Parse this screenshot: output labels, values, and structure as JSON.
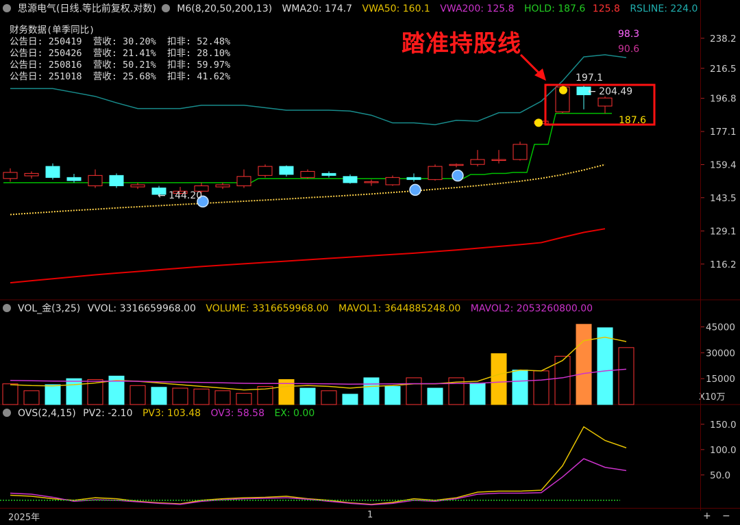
{
  "header_main": {
    "title": "思源电气(日线.等比前复权.对数)",
    "m6": "M6(8,20,50,200,13)",
    "wma20": "WMA20: 174.7",
    "vwa50": "VWA50: 160.1",
    "vwa200": "VWA200: 125.8",
    "hold_a": "HOLD: 187.6",
    "hold_b": "125.8",
    "rsline": "RSLINE: 224.0"
  },
  "financial": {
    "title": "财务数据(单季同比)",
    "rows": [
      "公告日: 250419  营收: 30.20%  扣非: 52.48%",
      "公告日: 250426  营收: 21.41%  扣非: 28.10%",
      "公告日: 250816  营收: 50.21%  扣非: 59.97%",
      "公告日: 251018  营收: 25.68%  扣非: 41.62%"
    ]
  },
  "annotation": {
    "text": "踏准持股线"
  },
  "header_vol": {
    "name": "VOL_金(3,25)",
    "vvol": "VVOL: 3316659968.00",
    "volume": "VOLUME: 3316659968.00",
    "mavol1": "MAVOL1: 3644885248.00",
    "mavol2": "MAVOL2: 2053260800.00"
  },
  "header_ovs": {
    "name": "OVS(2,4,15)",
    "pv2": "PV2: -2.10",
    "pv3": "PV3: 103.48",
    "ov3": "OV3: 58.58",
    "ex": "EX: 0.00"
  },
  "xaxis": {
    "left_label": "2025年",
    "mid_label": "1"
  },
  "zoom": {
    "plus": "+",
    "minus": "−"
  },
  "colors": {
    "up": "#ff3333",
    "down": "#54ffff",
    "hold": "#00c000",
    "wma": "#ffd24a",
    "red_line": "#e60000",
    "teal": "#188c8c",
    "magenta": "#cc33cc",
    "orange": "#ff8a3c",
    "gold": "#ffc000"
  },
  "chart_data": [
    {
      "type": "candlestick",
      "panel": "price",
      "yscale": "log",
      "ylim": [
        106,
        252
      ],
      "yticks": [
        "238.2",
        "216.5",
        "196.8",
        "177.1",
        "159.4",
        "143.5",
        "129.1",
        "116.2"
      ],
      "bars": [
        {
          "o": 152.5,
          "c": 155.5,
          "h": 157.5,
          "l": 151.0
        },
        {
          "o": 153.8,
          "c": 155.0,
          "h": 156.0,
          "l": 152.5
        },
        {
          "o": 158.5,
          "c": 153.0,
          "h": 160.0,
          "l": 152.0
        },
        {
          "o": 153.0,
          "c": 151.5,
          "h": 154.8,
          "l": 150.5
        },
        {
          "o": 149.0,
          "c": 154.0,
          "h": 157.0,
          "l": 148.0
        },
        {
          "o": 154.0,
          "c": 149.0,
          "h": 155.0,
          "l": 148.0
        },
        {
          "o": 148.5,
          "c": 149.5,
          "h": 150.5,
          "l": 147.5
        },
        {
          "o": 148.0,
          "c": 145.0,
          "h": 149.0,
          "l": 144.2
        },
        {
          "o": 145.5,
          "c": 146.5,
          "h": 148.5,
          "l": 145.0
        },
        {
          "o": 146.5,
          "c": 149.0,
          "h": 150.5,
          "l": 145.5
        },
        {
          "o": 148.5,
          "c": 149.5,
          "h": 150.5,
          "l": 147.5
        },
        {
          "o": 149.0,
          "c": 153.5,
          "h": 157.0,
          "l": 148.0
        },
        {
          "o": 154.0,
          "c": 158.5,
          "h": 159.5,
          "l": 153.0
        },
        {
          "o": 158.5,
          "c": 154.5,
          "h": 159.0,
          "l": 153.5
        },
        {
          "o": 153.0,
          "c": 156.0,
          "h": 157.0,
          "l": 152.5
        },
        {
          "o": 155.0,
          "c": 154.0,
          "h": 156.0,
          "l": 153.0
        },
        {
          "o": 153.5,
          "c": 150.5,
          "h": 154.5,
          "l": 150.0
        },
        {
          "o": 150.5,
          "c": 151.0,
          "h": 152.0,
          "l": 149.0
        },
        {
          "o": 149.5,
          "c": 153.0,
          "h": 154.0,
          "l": 149.0
        },
        {
          "o": 153.0,
          "c": 152.0,
          "h": 155.0,
          "l": 151.0
        },
        {
          "o": 152.0,
          "c": 158.5,
          "h": 159.5,
          "l": 151.5
        },
        {
          "o": 159.0,
          "c": 159.5,
          "h": 160.0,
          "l": 158.0
        },
        {
          "o": 159.5,
          "c": 162.0,
          "h": 167.0,
          "l": 158.5
        },
        {
          "o": 161.5,
          "c": 162.0,
          "h": 167.0,
          "l": 160.0
        },
        {
          "o": 162.0,
          "c": 170.0,
          "h": 171.5,
          "l": 161.5
        },
        {
          "o": 181.5,
          "c": 183.0,
          "h": 184.0,
          "l": 180.5
        },
        {
          "o": 188.5,
          "c": 204.0,
          "h": 205.0,
          "l": 187.8
        },
        {
          "o": 204.0,
          "c": 199.0,
          "h": 205.5,
          "l": 190.0
        },
        {
          "o": 192.0,
          "c": 197.0,
          "h": 198.0,
          "l": 187.6
        }
      ],
      "lines": [
        {
          "name": "HOLD",
          "values": [
            150.5,
            150.5,
            150.5,
            150.5,
            150.5,
            150.5,
            150.5,
            150.5,
            150.5,
            150.5,
            150.5,
            150.5,
            152.5,
            152.5,
            152.5,
            152.5,
            152.5,
            152.5,
            152.5,
            152.5,
            152.5,
            152.5,
            154.5,
            155.0,
            155.5,
            170.0,
            187.6,
            187.6,
            187.6
          ]
        },
        {
          "name": "WMA20",
          "values": [
            136.0,
            136.6,
            137.2,
            137.8,
            138.3,
            138.9,
            139.4,
            139.9,
            140.4,
            140.9,
            141.4,
            141.9,
            142.4,
            142.9,
            143.5,
            144.0,
            144.6,
            145.2,
            145.9,
            146.6,
            147.4,
            148.2,
            149.1,
            150.1,
            151.2,
            152.6,
            154.4,
            156.7,
            159.4
          ]
        },
        {
          "name": "red",
          "values": [
            109.5,
            110.2,
            110.9,
            111.6,
            112.3,
            112.9,
            113.5,
            114.1,
            114.7,
            115.3,
            115.8,
            116.3,
            116.8,
            117.3,
            117.8,
            118.3,
            118.8,
            119.3,
            119.8,
            120.3,
            120.9,
            121.5,
            122.2,
            122.9,
            123.6,
            124.4,
            126.5,
            128.5,
            130.0
          ]
        },
        {
          "name": "RSLINE",
          "values": [
            203.0,
            203.0,
            203.0,
            200.5,
            198.0,
            194.0,
            190.5,
            190.5,
            190.5,
            192.5,
            192.5,
            192.5,
            191.0,
            189.5,
            189.5,
            189.5,
            189.0,
            186.5,
            182.0,
            182.0,
            181.0,
            183.5,
            183.0,
            188.0,
            188.0,
            195.0,
            208.0,
            224.5,
            226.0,
            224.0
          ]
        }
      ],
      "labels": [
        "197.1",
        "204.49",
        "144.20",
        "187.6",
        "98.3",
        "90.6"
      ]
    },
    {
      "type": "bar",
      "panel": "volume",
      "ylim": [
        0,
        48000
      ],
      "yticks": [
        "45000",
        "30000",
        "15000"
      ],
      "unit_label": "X10万",
      "values": [
        12000,
        8000,
        11500,
        15000,
        14500,
        16500,
        11000,
        10000,
        9500,
        9000,
        8000,
        6500,
        10500,
        14500,
        9500,
        8000,
        6000,
        15500,
        10500,
        15500,
        9500,
        15500,
        12500,
        29500,
        20000,
        19500,
        28000,
        46500,
        44500,
        33000
      ],
      "bar_types": [
        "up",
        "up",
        "down",
        "down",
        "up",
        "down",
        "up",
        "down",
        "up",
        "up",
        "up",
        "up",
        "up",
        "gold",
        "down",
        "up",
        "down",
        "down",
        "down",
        "up",
        "down",
        "up",
        "down",
        "gold",
        "down",
        "up",
        "up",
        "orange",
        "down",
        "up"
      ],
      "series": [
        {
          "name": "MAVOL1",
          "values": [
            11500,
            11000,
            10800,
            11500,
            12500,
            14000,
            13500,
            12500,
            11500,
            10500,
            9500,
            8500,
            9000,
            10500,
            11000,
            10500,
            9500,
            10500,
            11000,
            12000,
            12000,
            13000,
            13500,
            17500,
            20000,
            19500,
            25500,
            37000,
            39000,
            36500
          ]
        },
        {
          "name": "MAVOL2",
          "values": [
            14000,
            13800,
            13600,
            13500,
            13500,
            13600,
            13500,
            13200,
            13000,
            12800,
            12600,
            12300,
            12200,
            12200,
            12100,
            12000,
            11800,
            11900,
            12000,
            12100,
            12100,
            12200,
            12300,
            13000,
            13600,
            14200,
            15500,
            18000,
            19500,
            20500
          ]
        }
      ]
    },
    {
      "type": "line",
      "panel": "ovs",
      "ylim": [
        -15,
        170
      ],
      "yticks": [
        "150.0",
        "100.0",
        "50.0"
      ],
      "series": [
        {
          "name": "PV3",
          "values": [
            10,
            8,
            3,
            0,
            5,
            3,
            -2,
            -5,
            -7,
            0,
            3,
            5,
            6,
            8,
            3,
            0,
            -5,
            -8,
            -4,
            3,
            0,
            5,
            16,
            18,
            18,
            20,
            68,
            145,
            118,
            103.48
          ]
        },
        {
          "name": "OV3",
          "values": [
            14,
            12,
            6,
            -2,
            1,
            0,
            -3,
            -6,
            -8,
            -2,
            1,
            3,
            4,
            5,
            2,
            -2,
            -6,
            -9,
            -6,
            0,
            -2,
            3,
            12,
            14,
            14,
            15,
            46,
            82,
            65,
            58.58
          ]
        },
        {
          "name": "EX",
          "values": [
            0,
            0,
            0,
            0,
            0,
            0,
            0,
            0,
            0,
            0,
            0,
            0,
            0,
            0,
            0,
            0,
            0,
            0,
            0,
            0,
            0,
            0,
            0,
            0,
            0,
            0,
            0,
            0,
            0,
            0
          ]
        }
      ]
    }
  ]
}
